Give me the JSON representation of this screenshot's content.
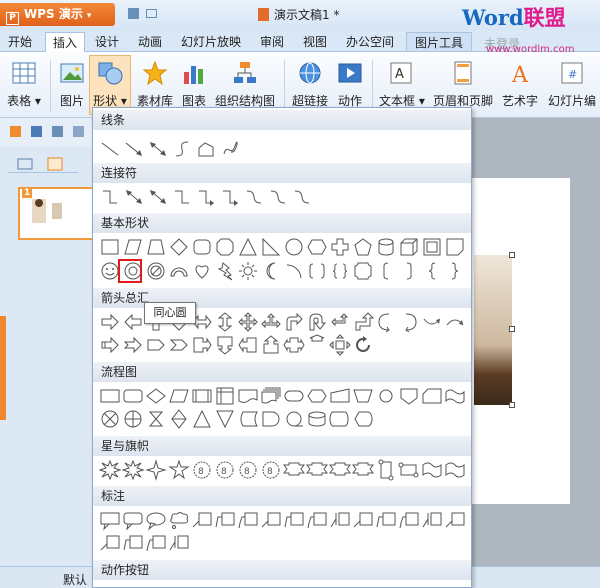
{
  "app": {
    "name": "WPS 演示",
    "doc_title": "演示文稿1 *"
  },
  "watermark": {
    "brand_word": "Word",
    "brand_cn": "联盟",
    "url": "www.wordlm.com"
  },
  "tabs": [
    "开始",
    "插入",
    "设计",
    "动画",
    "幻灯片放映",
    "审阅",
    "视图",
    "办公空间",
    "图片工具"
  ],
  "active_tab": "插入",
  "login_label": "未登录",
  "ribbon": [
    {
      "label": "表格 ▾",
      "icon": "table-icon"
    },
    {
      "label": "图片",
      "icon": "picture-icon"
    },
    {
      "label": "形状 ▾",
      "icon": "shapes-icon"
    },
    {
      "label": "素材库",
      "icon": "star-icon"
    },
    {
      "label": "图表",
      "icon": "chart-icon"
    },
    {
      "label": "组织结构图",
      "icon": "org-chart-icon"
    },
    {
      "label": "超链接",
      "icon": "globe-icon"
    },
    {
      "label": "动作",
      "icon": "action-icon"
    },
    {
      "label": "文本框 ▾",
      "icon": "textbox-icon"
    },
    {
      "label": "页眉和页脚",
      "icon": "header-footer-icon"
    },
    {
      "label": "艺术字",
      "icon": "wordart-icon"
    },
    {
      "label": "幻灯片编",
      "icon": "slide-number-icon"
    }
  ],
  "slide_number": "1",
  "status_text": "默认",
  "sections": [
    {
      "title": "线条",
      "count": 8
    },
    {
      "title": "连接符",
      "count": 9
    },
    {
      "title": "基本形状",
      "count": 32
    },
    {
      "title": "箭头总汇",
      "count": 27
    },
    {
      "title": "流程图",
      "count": 28
    },
    {
      "title": "星与旗帜",
      "count": 16
    },
    {
      "title": "标注",
      "count": 20
    },
    {
      "title": "动作按钮",
      "count": 0
    }
  ],
  "tooltip": "同心圆",
  "colors": {
    "accent": "#f0892e",
    "selection": "#e31b1b",
    "ribbon_bg": "#e6eef8"
  }
}
